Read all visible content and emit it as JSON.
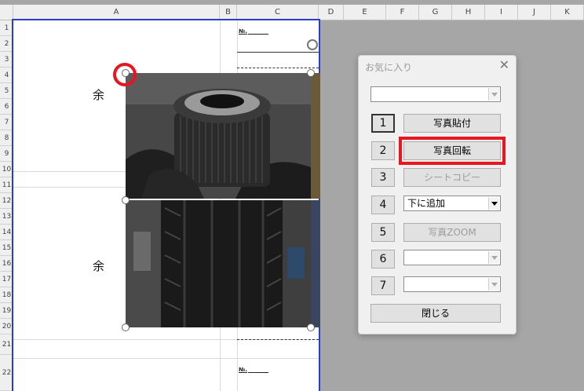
{
  "columns": [
    "A",
    "B",
    "C",
    "D",
    "E",
    "F",
    "G",
    "H",
    "I",
    "J",
    "K"
  ],
  "rows": [
    "1",
    "2",
    "3",
    "4",
    "5",
    "6",
    "7",
    "8",
    "9",
    "10",
    "11",
    "12",
    "13",
    "14",
    "15",
    "16",
    "17",
    "18",
    "19",
    "20",
    "21",
    "22"
  ],
  "sheet": {
    "no_label_top": "№.",
    "no_label_bottom": "№.",
    "yo_top": "余",
    "yo_bottom": "余"
  },
  "dialog": {
    "title": "お気に入り",
    "close_glyph": "✕",
    "top_combo_value": "",
    "rows": [
      {
        "number": "1",
        "action": "写真貼付",
        "type": "button",
        "enabled": true
      },
      {
        "number": "2",
        "action": "写真回転",
        "type": "button",
        "enabled": true
      },
      {
        "number": "3",
        "action": "シートコピー",
        "type": "button",
        "enabled": false
      },
      {
        "number": "4",
        "action": "下に追加",
        "type": "combo",
        "enabled": true
      },
      {
        "number": "5",
        "action": "写真ZOOM",
        "type": "button",
        "enabled": false
      },
      {
        "number": "6",
        "action": "",
        "type": "combo",
        "enabled": false
      },
      {
        "number": "7",
        "action": "",
        "type": "combo",
        "enabled": false
      }
    ],
    "close_button": "閉じる"
  },
  "colors": {
    "highlight": "#e8161e",
    "page_break": "#2a3ec9"
  }
}
